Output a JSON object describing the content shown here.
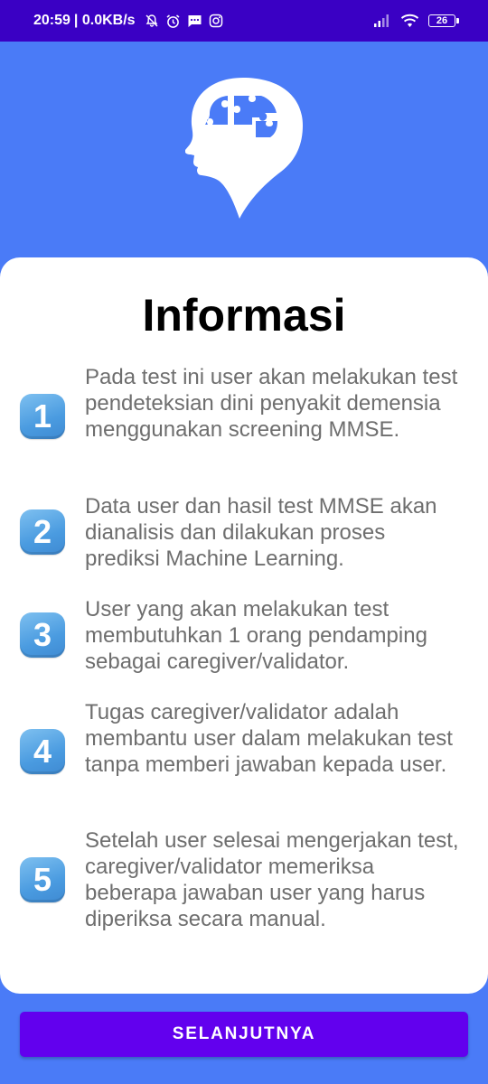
{
  "status_bar": {
    "time": "20:59",
    "speed": "| 0.0KB/s",
    "battery": "26",
    "icons": [
      "bell-muted-icon",
      "alarm-clock-icon",
      "message-icon",
      "instagram-icon",
      "signal-icon",
      "wifi-icon",
      "battery-icon"
    ]
  },
  "logo": {
    "icon": "brain-puzzle-head-icon"
  },
  "card": {
    "title": "Informasi",
    "items": [
      {
        "number": "1",
        "text": "Pada test ini user akan melakukan test pendeteksian dini penyakit demensia menggunakan screening MMSE."
      },
      {
        "number": "2",
        "text": "Data user dan hasil test MMSE akan dianalisis dan dilakukan proses prediksi Machine Learning."
      },
      {
        "number": "3",
        "text": "User yang akan melakukan test membutuhkan 1 orang pendamping sebagai caregiver/validator."
      },
      {
        "number": "4",
        "text": "Tugas caregiver/validator adalah membantu user dalam melakukan test tanpa memberi jawaban kepada user."
      },
      {
        "number": "5",
        "text": "Setelah user selesai mengerjakan test, caregiver/validator memeriksa beberapa jawaban user yang harus diperiksa secara manual."
      }
    ]
  },
  "next_button": {
    "label": "SELANJUTNYA"
  },
  "colors": {
    "background": "#4A7BF7",
    "status_bar": "#3A00C4",
    "button": "#6200EE",
    "badge": "#4A9BE0",
    "body_text": "#6E6E6E"
  }
}
